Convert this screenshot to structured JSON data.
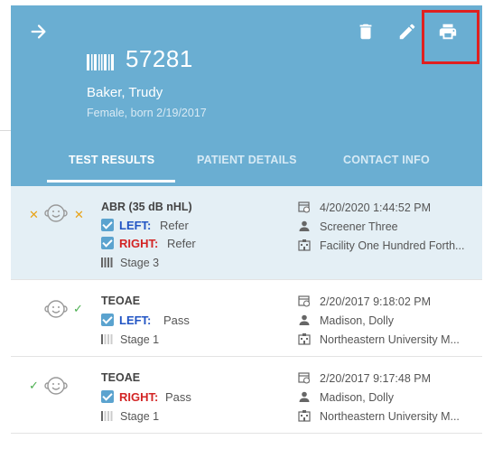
{
  "header": {
    "patient_id": "57281",
    "patient_name": "Baker, Trudy",
    "patient_info": "Female, born 2/19/2017",
    "icons": [
      "arrow-right-icon",
      "trash-icon",
      "pencil-icon",
      "printer-icon",
      "barcode-icon"
    ],
    "colors": {
      "header_bg": "#6aaed2",
      "highlight": "#e02020"
    }
  },
  "tabs": [
    {
      "label": "TEST RESULTS",
      "active": true
    },
    {
      "label": "PATIENT DETAILS",
      "active": false
    },
    {
      "label": "CONTACT INFO",
      "active": false
    }
  ],
  "results": [
    {
      "test": "ABR (35 dB nHL)",
      "ears": [
        {
          "side": "LEFT:",
          "result": "Refer"
        },
        {
          "side": "RIGHT:",
          "result": "Refer"
        }
      ],
      "stage": "Stage 3",
      "datetime": "4/20/2020 1:44:52 PM",
      "screener": "Screener Three",
      "facility": "Facility One Hundred Forth..."
    },
    {
      "test": "TEOAE",
      "ears": [
        {
          "side": "LEFT:",
          "result": "Pass"
        }
      ],
      "stage": "Stage 1",
      "datetime": "2/20/2017 9:18:02 PM",
      "screener": "Madison, Dolly",
      "facility": "Northeastern University M..."
    },
    {
      "test": "TEOAE",
      "ears": [
        {
          "side": "RIGHT:",
          "result": "Pass"
        }
      ],
      "stage": "Stage 1",
      "datetime": "2/20/2017 9:17:48 PM",
      "screener": "Madison, Dolly",
      "facility": "Northeastern University M..."
    }
  ]
}
